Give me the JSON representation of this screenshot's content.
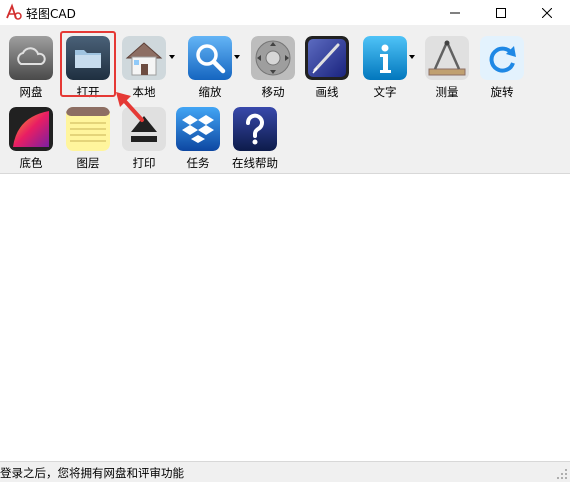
{
  "window": {
    "title": "轻图CAD",
    "controls": [
      "minimize-icon",
      "maximize-icon",
      "close-icon"
    ]
  },
  "toolbar": {
    "row1": [
      {
        "id": "cloud",
        "label": "网盘",
        "icon": "cloud-icon"
      },
      {
        "id": "open",
        "label": "打开",
        "icon": "folder-icon",
        "highlighted": true
      },
      {
        "id": "local",
        "label": "本地",
        "icon": "house-icon",
        "dropdown": true
      },
      {
        "id": "zoom",
        "label": "缩放",
        "icon": "magnifier-icon",
        "dropdown": true
      },
      {
        "id": "move",
        "label": "移动",
        "icon": "move-dpad-icon"
      },
      {
        "id": "draw",
        "label": "画线",
        "icon": "pen-icon"
      },
      {
        "id": "text",
        "label": "文字",
        "icon": "info-icon",
        "dropdown": true
      },
      {
        "id": "measure",
        "label": "测量",
        "icon": "ruler-compass-icon"
      },
      {
        "id": "rotate",
        "label": "旋转",
        "icon": "rotate-icon"
      }
    ],
    "row2": [
      {
        "id": "bgcolor",
        "label": "底色",
        "icon": "color-swatch-icon"
      },
      {
        "id": "layers",
        "label": "图层",
        "icon": "notepad-icon"
      },
      {
        "id": "print",
        "label": "打印",
        "icon": "eject-print-icon"
      },
      {
        "id": "tasks",
        "label": "任务",
        "icon": "dropbox-icon"
      },
      {
        "id": "help",
        "label": "在线帮助",
        "icon": "question-icon"
      }
    ]
  },
  "status": {
    "text": "登录之后，您将拥有网盘和评审功能"
  },
  "colors": {
    "highlight": "#e53935",
    "toolbar_bg": "#f0f0f0"
  }
}
